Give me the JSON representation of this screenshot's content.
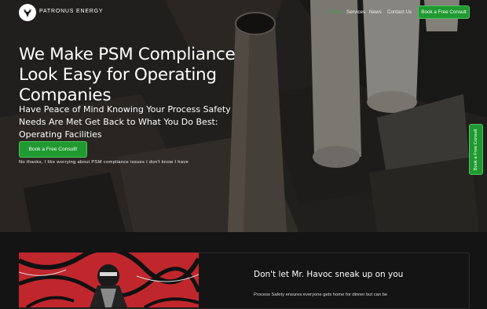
{
  "header": {
    "brand": "PATRONUS ENERGY",
    "nav": [
      "Home",
      "Services",
      "News",
      "Contact Us"
    ],
    "cta": "Book a Free Consult"
  },
  "hero": {
    "headline": "We Make PSM Compliance Look Easy for Operating Companies",
    "subheadline": "Have Peace of Mind Knowing Your Process Safety Needs Are Met Get Back to What You Do Best: Operating Facilities",
    "cta": "Book a Free Consult!",
    "decline": "No thanks, I like worrying about PSM compliance issues I don't know I have"
  },
  "side_tab": "Book a Free Consult",
  "section": {
    "title": "Don't let Mr. Havoc sneak up on you",
    "text": "Process Safety ensures everyone gets home for dinner but can be"
  },
  "colors": {
    "accent": "#1f9a30",
    "nav_active": "#3ea83e",
    "background": "#141414"
  },
  "icons": {
    "logo": "deer-head-icon"
  }
}
